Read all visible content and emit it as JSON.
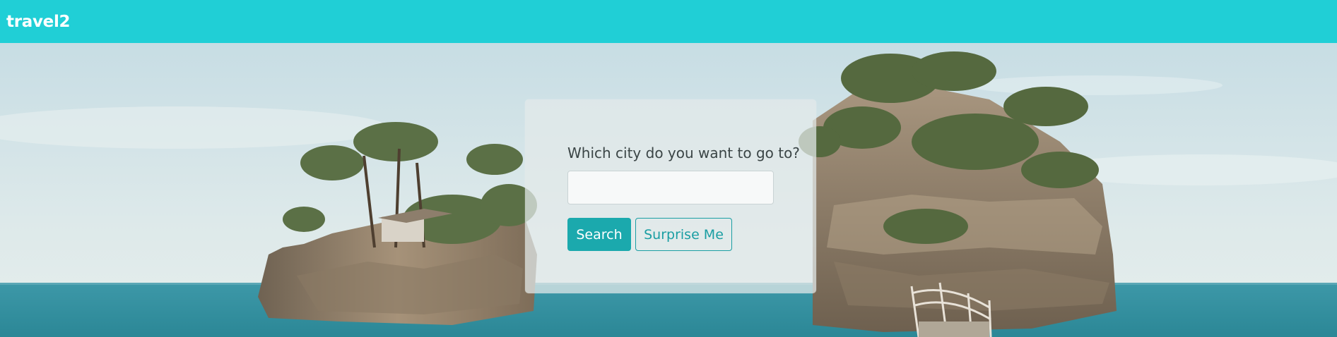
{
  "navbar": {
    "brand": "travel2",
    "background_color": "#20cfd6"
  },
  "hero": {
    "image": "coastal-island-photo"
  },
  "search_panel": {
    "label": "Which city do you want to go to?",
    "input_value": "",
    "input_placeholder": "",
    "search_button": "Search",
    "surprise_button": "Surprise Me",
    "accent_color": "#1ba9ad"
  }
}
